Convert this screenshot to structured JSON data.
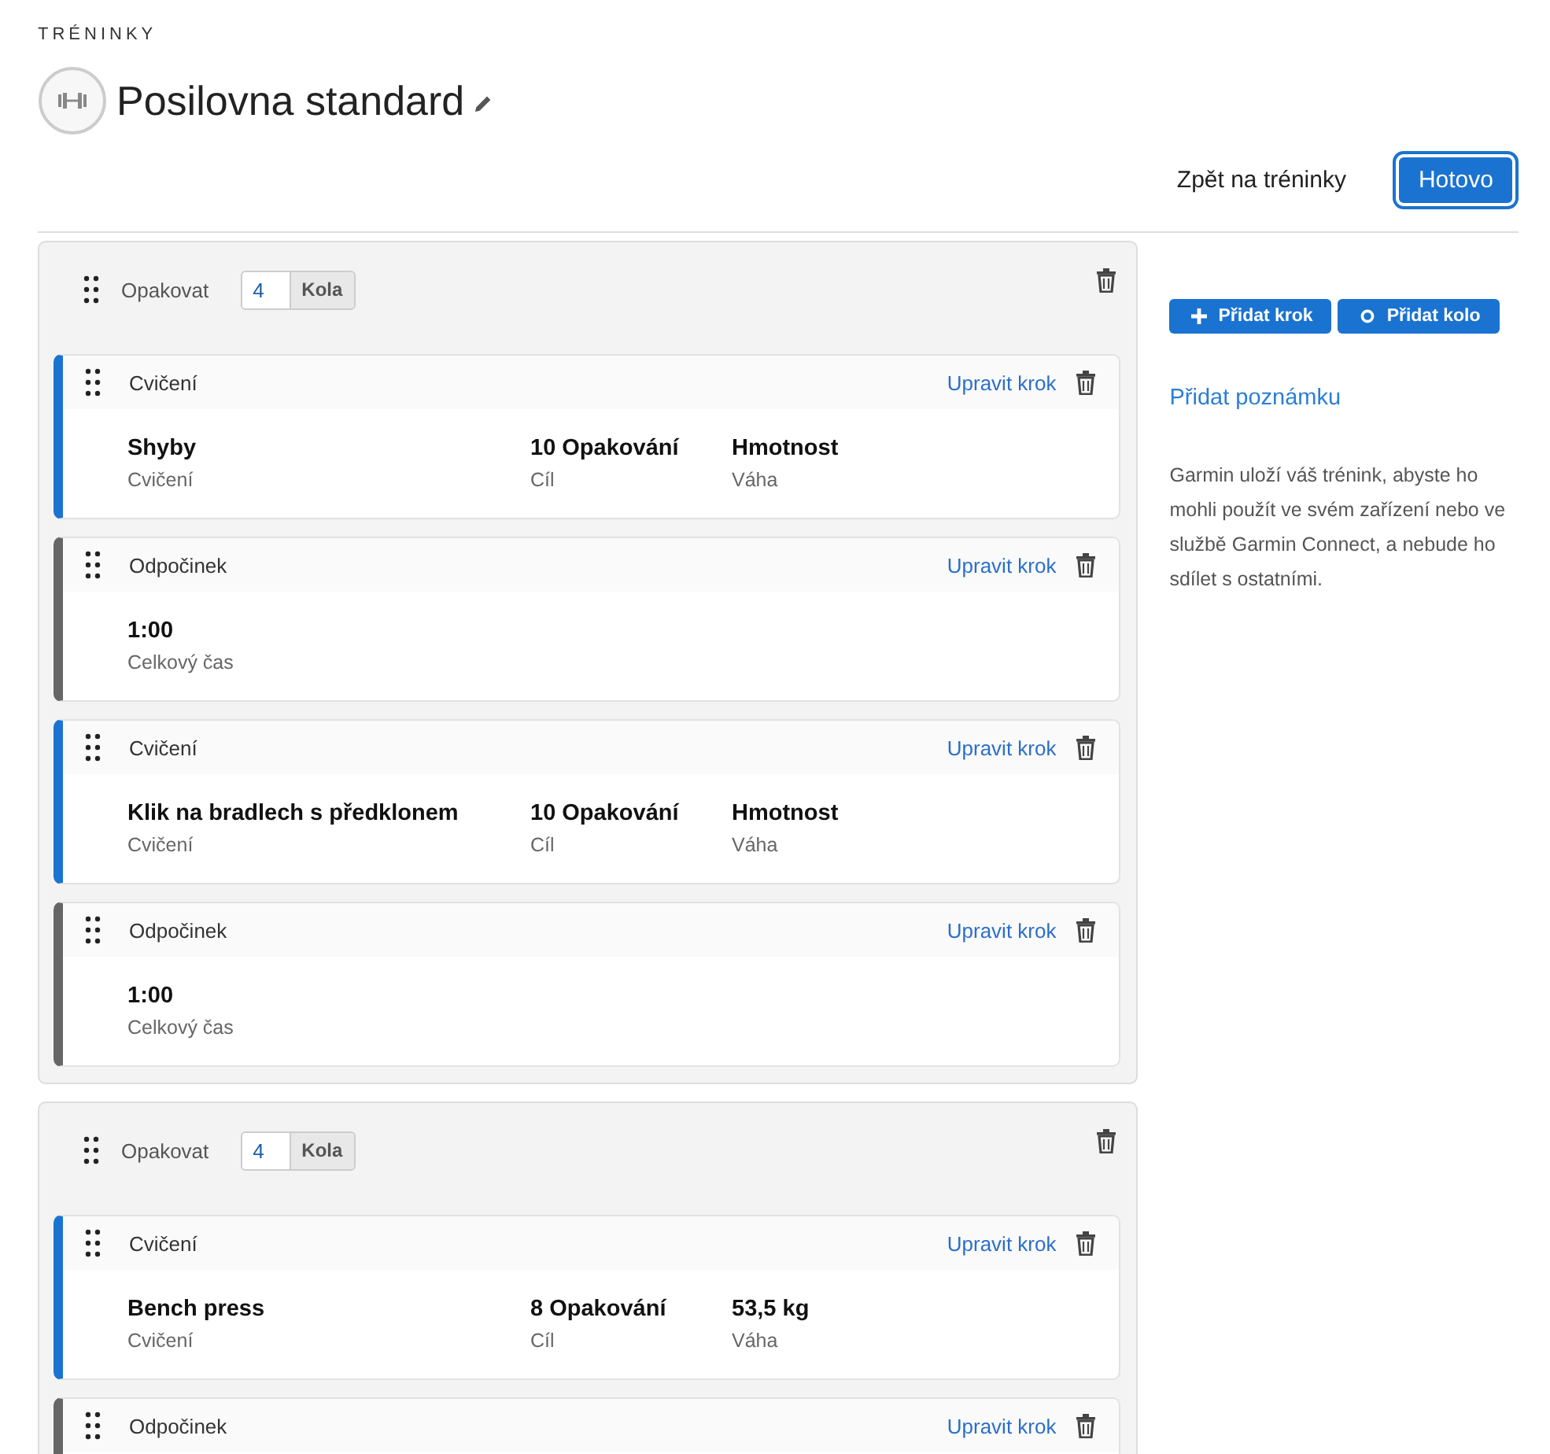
{
  "breadcrumb": "TRÉNINKY",
  "title": "Posilovna standard",
  "actions": {
    "back_link": "Zpět na tréninky",
    "done_button": "Hotovo"
  },
  "blocks": [
    {
      "repeat_label": "Opakovat",
      "count": "4",
      "unit": "Kola",
      "steps": [
        {
          "kind": "exercise",
          "type_label": "Cvičení",
          "edit_link": "Upravit krok",
          "fields": [
            {
              "value": "Shyby",
              "label": "Cvičení"
            },
            {
              "value": "10 Opakování",
              "label": "Cíl"
            },
            {
              "value": "Hmotnost",
              "label": "Váha"
            }
          ]
        },
        {
          "kind": "rest",
          "type_label": "Odpočinek",
          "edit_link": "Upravit krok",
          "fields": [
            {
              "value": "1:00",
              "label": "Celkový čas"
            }
          ]
        },
        {
          "kind": "exercise",
          "type_label": "Cvičení",
          "edit_link": "Upravit krok",
          "fields": [
            {
              "value": "Klik na bradlech s předklonem",
              "label": "Cvičení"
            },
            {
              "value": "10 Opakování",
              "label": "Cíl"
            },
            {
              "value": "Hmotnost",
              "label": "Váha"
            }
          ]
        },
        {
          "kind": "rest",
          "type_label": "Odpočinek",
          "edit_link": "Upravit krok",
          "fields": [
            {
              "value": "1:00",
              "label": "Celkový čas"
            }
          ]
        }
      ]
    },
    {
      "repeat_label": "Opakovat",
      "count": "4",
      "unit": "Kola",
      "steps": [
        {
          "kind": "exercise",
          "type_label": "Cvičení",
          "edit_link": "Upravit krok",
          "fields": [
            {
              "value": "Bench press",
              "label": "Cvičení"
            },
            {
              "value": "8 Opakování",
              "label": "Cíl"
            },
            {
              "value": "53,5 kg",
              "label": "Váha"
            }
          ]
        },
        {
          "kind": "rest",
          "type_label": "Odpočinek",
          "edit_link": "Upravit krok"
        }
      ]
    }
  ],
  "sidebar": {
    "add_step": "Přidat krok",
    "add_round": "Přidat kolo",
    "add_note": "Přidat poznámku",
    "info": "Garmin uloží váš trénink, abyste ho mohli použít ve svém zařízení nebo ve službě Garmin Connect, a nebude ho sdílet s ostatními."
  }
}
